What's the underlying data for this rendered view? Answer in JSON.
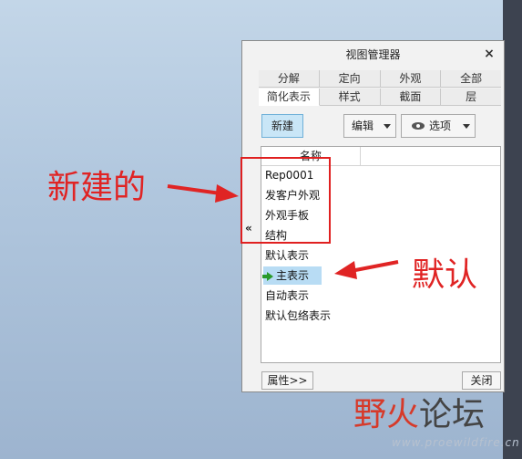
{
  "dialog": {
    "title": "视图管理器",
    "close": "×",
    "tabs_row1": [
      "分解",
      "定向",
      "外观",
      "全部"
    ],
    "tabs_row2": [
      "简化表示",
      "样式",
      "截面",
      "层"
    ],
    "active_tab": "简化表示",
    "toolbar": {
      "new_label": "新建",
      "edit_label": "编辑",
      "options_label": "选项"
    },
    "list": {
      "column_header": "名称",
      "items": [
        "Rep0001",
        "发客户外观",
        "外观手板",
        "结构",
        "默认表示",
        "主表示",
        "自动表示",
        "默认包络表示"
      ],
      "active_item": "主表示"
    },
    "collapse_label": "«",
    "bottom": {
      "properties_label": "属性>>",
      "close_label": "关闭"
    }
  },
  "annotations": {
    "new_label": "新建的",
    "default_label": "默认",
    "color": "#e02424"
  },
  "watermark": {
    "part1": "野火",
    "part2": "论坛",
    "url": "www.proewildfire.cn"
  }
}
